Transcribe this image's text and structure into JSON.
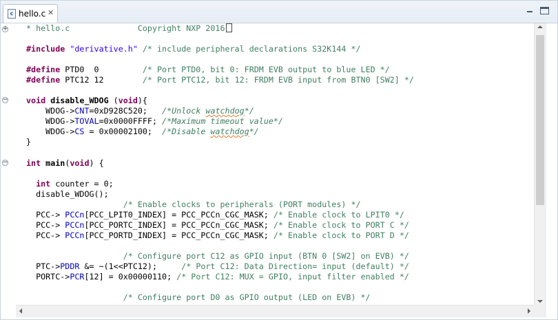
{
  "editor": {
    "tab": {
      "title": "hello.c",
      "icon_glyph": "c",
      "close_glyph": "✕",
      "icons": [
        "c-file-icon",
        "close-icon",
        "minimize-icon",
        "maximize-icon"
      ]
    },
    "fold_glyphs": {
      "collapsed": "+",
      "expanded": "−"
    },
    "colors": {
      "keyword": "#7f0055",
      "string": "#2a00ff",
      "comment": "#3f7f5f",
      "field": "#0000c0",
      "spelling": "#e07a2b"
    },
    "code": {
      "l1": {
        "comment": "* hello.c              Copyright NXP 2016"
      },
      "l2": {
        "kw": "#include",
        "str": "\"derivative.h\"",
        "comment": " /* include peripheral declarations S32K144 */"
      },
      "l3": {
        "kw": "#define",
        "code": " PTD0  0         ",
        "comment": "/* Port PTD0, bit 0: FRDM EVB output to blue LED */"
      },
      "l4": {
        "kw": "#define",
        "code": " PTC12 12        ",
        "comment": "/* Port PTC12, bit 12: FRDM EVB input from BTN0 [SW2] */"
      },
      "l5": {
        "kw1": "void",
        "fn": " disable_WDOG ",
        "p1": "(",
        "kw2": "void",
        "p2": "){"
      },
      "l6": {
        "a": "    WDOG->",
        "f": "CNT",
        "b": "=0xD928C520;   ",
        "c1": "/*Unlock ",
        "c2": "watchdog",
        "c3": "*/"
      },
      "l7": {
        "a": "    WDOG->",
        "f": "TOVAL",
        "b": "=0x0000FFFF; ",
        "c1": "/*Maximum timeout value*/"
      },
      "l8": {
        "a": "    WDOG->",
        "f": "CS",
        "b": " = 0x00002100;  ",
        "c1": "/*Disable ",
        "c2": "watchdog",
        "c3": "*/"
      },
      "l9": "}",
      "l10": {
        "kw": "int",
        "fn": " main",
        "p1": "(",
        "kw2": "void",
        "p2": ") {"
      },
      "l11": {
        "indent": "  ",
        "kw": "int",
        "code": " counter = 0;"
      },
      "l12": "  disable_WDOG();",
      "l13": "                    /* Enable clocks to peripherals (PORT modules) */",
      "l14": {
        "a": "  PCC-> ",
        "f": "PCCn",
        "b": "[PCC_LPIT0_INDEX] = PCC_PCCn_CGC_MASK; ",
        "c": "/* Enable clock to LPIT0 */"
      },
      "l15": {
        "a": "  PCC-> ",
        "f": "PCCn",
        "b": "[PCC_PORTC_INDEX] = PCC_PCCn_CGC_MASK; ",
        "c": "/* Enable clock to PORT C */"
      },
      "l16": {
        "a": "  PCC-> ",
        "f": "PCCn",
        "b": "[PCC_PORTD_INDEX] = PCC_PCCn_CGC_MASK; ",
        "c": "/* Enable clock to PORT D */"
      },
      "l17": "                    /* Configure port C12 as GPIO input (BTN 0 [SW2] on EVB) */",
      "l18": {
        "a": "  PTC->",
        "f": "PDDR",
        "b": " &= ~(1<<PTC12);     ",
        "c": "/* Port C12: Data Direction= input (default) */"
      },
      "l19": {
        "a": "  PORTC->",
        "f": "PCR",
        "b": "[12] = 0x00000110; ",
        "c": "/* Port C12: MUX = GPIO, input filter enabled */"
      },
      "l20": "                    /* Configure port D0 as GPIO output (LED on EVB) */"
    }
  }
}
